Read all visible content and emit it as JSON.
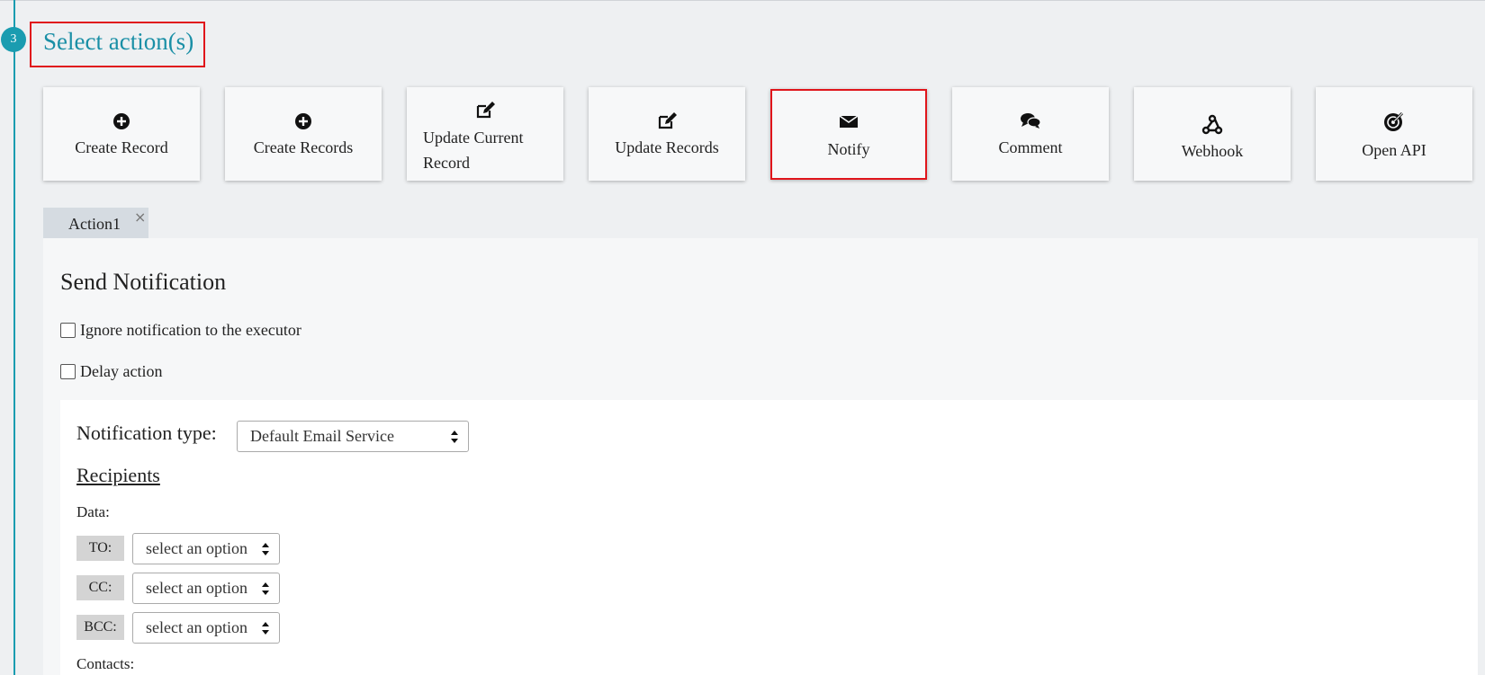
{
  "step": {
    "number": "3",
    "title": "Select action(s)"
  },
  "actions": [
    {
      "label": "Create Record",
      "icon": "plus-circle-icon"
    },
    {
      "label": "Create Records",
      "icon": "plus-circle-icon"
    },
    {
      "label": "Update Current Record",
      "icon": "edit-icon"
    },
    {
      "label": "Update Records",
      "icon": "edit-icon"
    },
    {
      "label": "Notify",
      "icon": "envelope-icon"
    },
    {
      "label": "Comment",
      "icon": "comments-icon"
    },
    {
      "label": "Webhook",
      "icon": "webhook-icon"
    },
    {
      "label": "Open API",
      "icon": "api-icon"
    }
  ],
  "tab": {
    "label": "Action1",
    "close": "×"
  },
  "panel": {
    "title": "Send Notification",
    "ignore_label": "Ignore notification to the executor",
    "delay_label": "Delay action"
  },
  "notification": {
    "type_label": "Notification type:",
    "type_value": "Default Email Service",
    "recipients_label": "Recipients",
    "data_label": "Data:",
    "to_label": "TO:",
    "cc_label": "CC:",
    "bcc_label": "BCC:",
    "to_value": "select an option",
    "cc_value": "select an option",
    "bcc_value": "select an option",
    "contacts_label": "Contacts:"
  },
  "colors": {
    "accent": "#1a9cb0",
    "highlight": "#e0151b"
  }
}
